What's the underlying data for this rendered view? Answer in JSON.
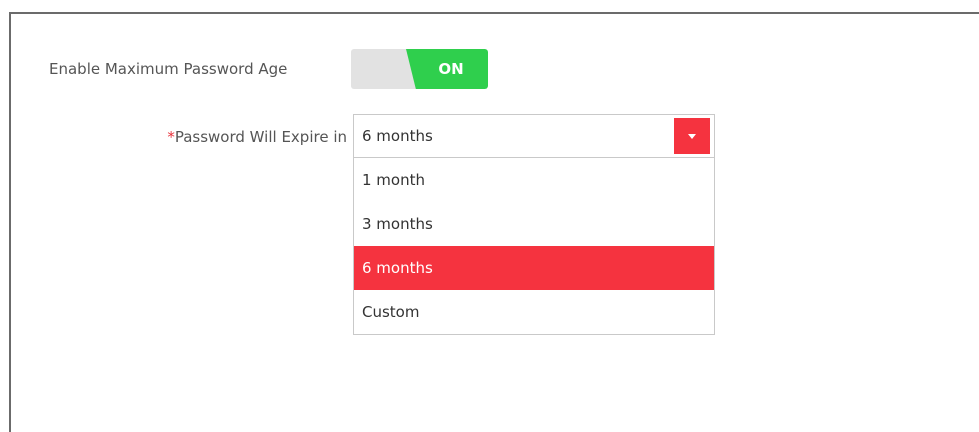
{
  "settings": {
    "max_age_label": "Enable Maximum Password Age",
    "toggle_state": "ON",
    "expire_required_marker": "*",
    "expire_label": "Password Will Expire in",
    "expire_selected": "6 months",
    "options": [
      {
        "label": "1 month",
        "selected": false
      },
      {
        "label": "3 months",
        "selected": false
      },
      {
        "label": "6 months",
        "selected": true
      },
      {
        "label": "Custom",
        "selected": false
      }
    ]
  },
  "colors": {
    "toggle_on": "#2fcf4d",
    "accent_red": "#f5333f",
    "required_star": "#e8323c"
  },
  "icons": {
    "dropdown_arrow": "chevron-down-icon"
  }
}
